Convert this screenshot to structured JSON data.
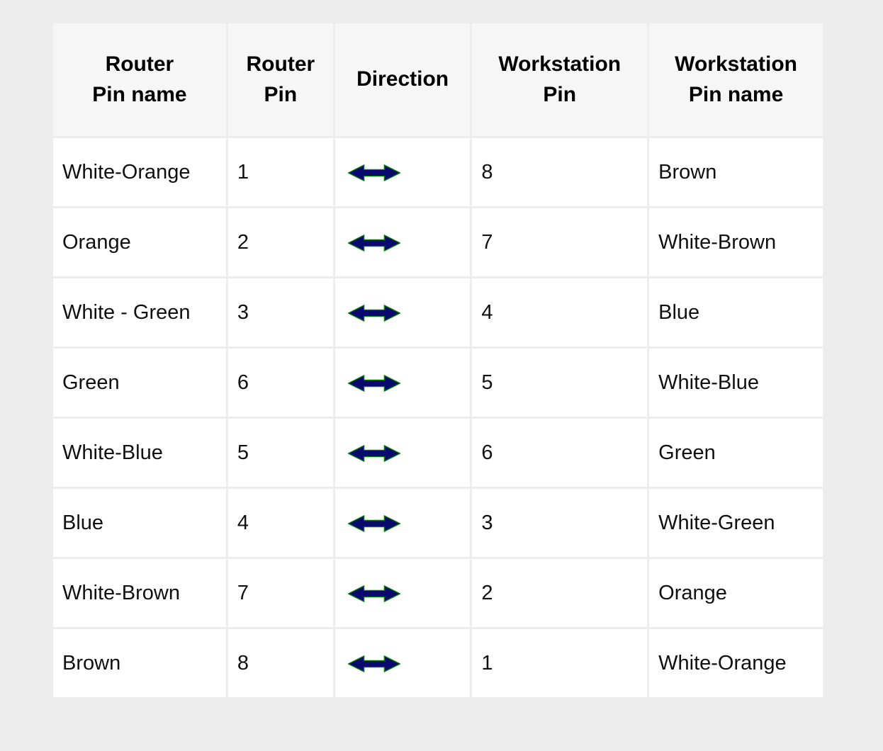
{
  "table": {
    "name": "router-workstation-pinout",
    "columns": [
      {
        "key": "router_pin_name",
        "label": "Router\nPin name",
        "label_line1": "Router",
        "label_line2": "Pin name",
        "align": "center"
      },
      {
        "key": "router_pin",
        "label": "Router\nPin",
        "label_line1": "Router",
        "label_line2": "Pin",
        "align": "center"
      },
      {
        "key": "direction",
        "label": "Direction",
        "label_line1": "Direction",
        "label_line2": "",
        "align": "center"
      },
      {
        "key": "workstation_pin",
        "label": "Workstation\nPin",
        "label_line1": "Workstation",
        "label_line2": "Pin",
        "align": "center"
      },
      {
        "key": "workstation_pin_name",
        "label": "Workstation\nPin name",
        "label_line1": "Workstation",
        "label_line2": "Pin name",
        "align": "center"
      }
    ],
    "direction_icon": "bidirectional-arrow-icon",
    "rows": [
      {
        "router_pin_name": "White-Orange",
        "router_pin": "1",
        "direction": "↔",
        "workstation_pin": "8",
        "workstation_pin_name": "Brown"
      },
      {
        "router_pin_name": "Orange",
        "router_pin": "2",
        "direction": "↔",
        "workstation_pin": "7",
        "workstation_pin_name": "White-Brown"
      },
      {
        "router_pin_name": "White - Green",
        "router_pin": "3",
        "direction": "↔",
        "workstation_pin": "4",
        "workstation_pin_name": "Blue"
      },
      {
        "router_pin_name": "Green",
        "router_pin": "6",
        "direction": "↔",
        "workstation_pin": "5",
        "workstation_pin_name": "White-Blue"
      },
      {
        "router_pin_name": "White-Blue",
        "router_pin": "5",
        "direction": "↔",
        "workstation_pin": "6",
        "workstation_pin_name": "Green"
      },
      {
        "router_pin_name": "Blue",
        "router_pin": "4",
        "direction": "↔",
        "workstation_pin": "3",
        "workstation_pin_name": "White-Green"
      },
      {
        "router_pin_name": "White-Brown",
        "router_pin": "7",
        "direction": "↔",
        "workstation_pin": "2",
        "workstation_pin_name": "Orange"
      },
      {
        "router_pin_name": "Brown",
        "router_pin": "8",
        "direction": "↔",
        "workstation_pin": "1",
        "workstation_pin_name": "White-Orange"
      }
    ]
  },
  "colors": {
    "page_background": "#ededed",
    "header_cell_background": "#f6f6f6",
    "body_cell_background": "#ffffff",
    "text": "#101010",
    "header_text": "#000000",
    "arrow_fill": "#0a0a6e",
    "arrow_outline": "#008000"
  }
}
